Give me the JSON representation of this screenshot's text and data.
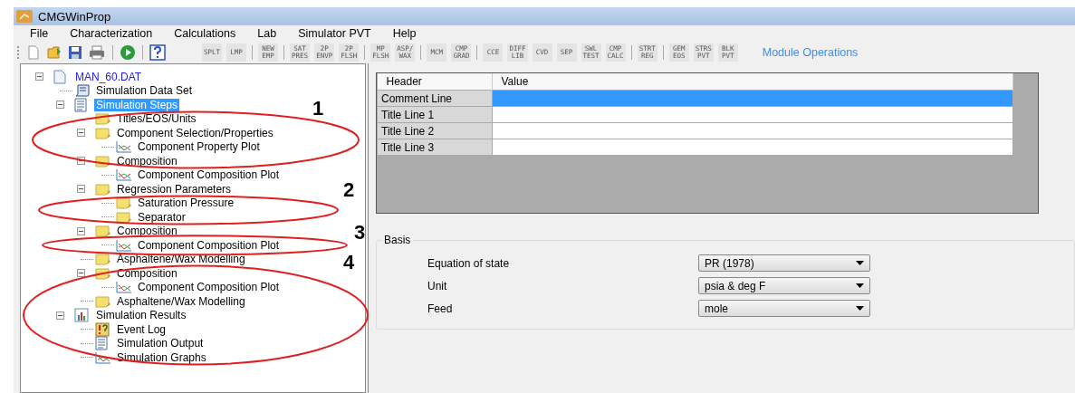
{
  "window": {
    "title": "CMGWinProp"
  },
  "menu": [
    "File",
    "Characterization",
    "Calculations",
    "Lab",
    "Simulator PVT",
    "Help"
  ],
  "toolbar": {
    "groups": [
      [
        {
          "lines": [
            "SPLT"
          ]
        },
        {
          "lines": [
            "LMP"
          ]
        }
      ],
      [
        {
          "lines": [
            "NEW",
            "EMP"
          ]
        }
      ],
      [
        {
          "lines": [
            "SAT",
            "PRES"
          ]
        },
        {
          "lines": [
            "2P",
            "ENVP"
          ]
        },
        {
          "lines": [
            "2P",
            "FLSH"
          ]
        }
      ],
      [
        {
          "lines": [
            "MP",
            "FLSH"
          ]
        },
        {
          "lines": [
            "ASP/",
            "WAX"
          ]
        }
      ],
      [
        {
          "lines": [
            "MCM"
          ]
        },
        {
          "lines": [
            "CMP",
            "GRAD"
          ]
        }
      ],
      [
        {
          "lines": [
            "CCE"
          ]
        },
        {
          "lines": [
            "DIFF",
            "LIB"
          ]
        },
        {
          "lines": [
            "CVD"
          ]
        },
        {
          "lines": [
            "SEP"
          ]
        },
        {
          "lines": [
            "SWL",
            "TEST"
          ]
        },
        {
          "lines": [
            "CMP",
            "CALC"
          ]
        }
      ],
      [
        {
          "lines": [
            "STRT",
            "REG"
          ]
        }
      ],
      [
        {
          "lines": [
            "GEM",
            "EOS"
          ]
        },
        {
          "lines": [
            "STRS",
            "PVT"
          ]
        },
        {
          "lines": [
            "BLK",
            "PVT"
          ]
        }
      ]
    ],
    "link": "Module Operations"
  },
  "tree": [
    {
      "label": "MAN_60.DAT",
      "kind": "file",
      "selected": false,
      "expanded": true,
      "children": [
        {
          "label": "Simulation Data Set",
          "kind": "script",
          "selected": false
        },
        {
          "label": "Simulation Steps",
          "kind": "doc",
          "selected": true,
          "expanded": true,
          "children": [
            {
              "label": "Titles/EOS/Units",
              "kind": "folder",
              "selected": false
            },
            {
              "label": "Component Selection/Properties",
              "kind": "folder",
              "selected": false,
              "expanded": true,
              "children": [
                {
                  "label": "Component Property Plot",
                  "kind": "chart",
                  "selected": false
                }
              ]
            },
            {
              "label": "Composition",
              "kind": "folder",
              "selected": false,
              "expanded": true,
              "children": [
                {
                  "label": "Component Composition Plot",
                  "kind": "chart",
                  "selected": false
                }
              ]
            },
            {
              "label": "Regression Parameters",
              "kind": "folder",
              "selected": false,
              "expanded": true,
              "children": [
                {
                  "label": "Saturation Pressure",
                  "kind": "folder",
                  "selected": false
                },
                {
                  "label": "Separator",
                  "kind": "folder",
                  "selected": false
                }
              ]
            },
            {
              "label": "Composition",
              "kind": "folder",
              "selected": false,
              "expanded": true,
              "children": [
                {
                  "label": "Component Composition Plot",
                  "kind": "chart",
                  "selected": false
                }
              ]
            },
            {
              "label": "Asphaltene/Wax Modelling",
              "kind": "folder",
              "selected": false
            },
            {
              "label": "Composition",
              "kind": "folder",
              "selected": false,
              "expanded": true,
              "children": [
                {
                  "label": "Component Composition Plot",
                  "kind": "chart",
                  "selected": false
                }
              ]
            },
            {
              "label": "Asphaltene/Wax Modelling",
              "kind": "folder",
              "selected": false
            }
          ]
        },
        {
          "label": "Simulation Results",
          "kind": "results",
          "selected": false,
          "expanded": true,
          "children": [
            {
              "label": "Event Log",
              "kind": "log",
              "selected": false
            },
            {
              "label": "Simulation Output",
              "kind": "doc",
              "selected": false
            },
            {
              "label": "Simulation Graphs",
              "kind": "chart",
              "selected": false
            }
          ]
        }
      ]
    }
  ],
  "annotations": [
    {
      "label": "1"
    },
    {
      "label": "2"
    },
    {
      "label": "3"
    },
    {
      "label": "4"
    }
  ],
  "grid": {
    "columns": [
      "Header",
      "Value"
    ],
    "rows": [
      {
        "header": "Comment Line",
        "selected": true
      },
      {
        "header": "Title Line 1",
        "selected": false
      },
      {
        "header": "Title Line 2",
        "selected": false
      },
      {
        "header": "Title Line 3",
        "selected": false
      }
    ]
  },
  "basis": {
    "title": "Basis",
    "fields": [
      {
        "label": "Equation of state",
        "value": "PR (1978)"
      },
      {
        "label": "Unit",
        "value": "psia & deg F"
      },
      {
        "label": "Feed",
        "value": "mole"
      }
    ]
  }
}
